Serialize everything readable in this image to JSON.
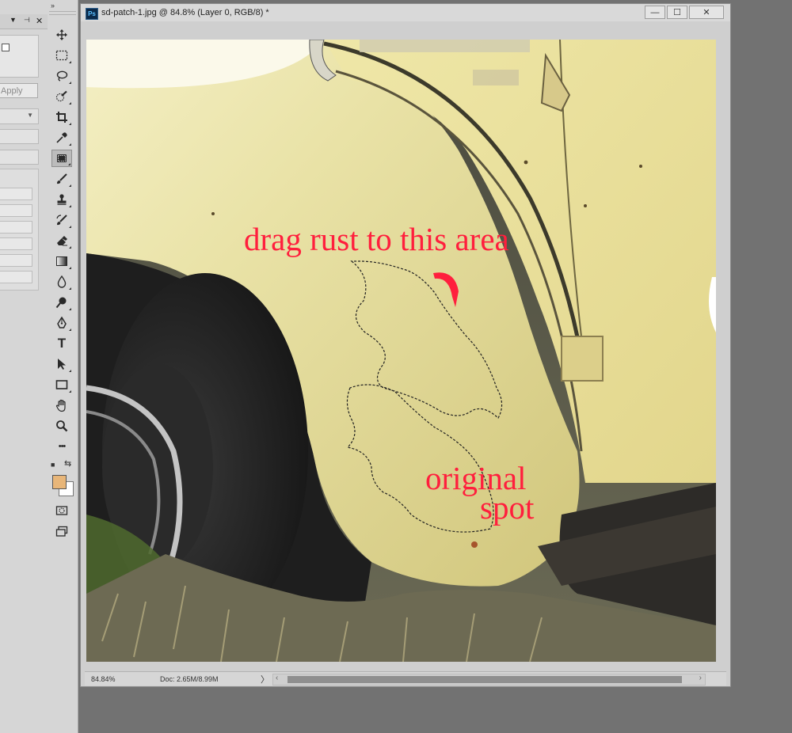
{
  "options_panel": {
    "collapse_icon": "chevron-down-icon",
    "pin_icon": "pin-icon",
    "close_glyph": "✕",
    "apply_label": "Apply"
  },
  "toolbar": {
    "collapse_glyph": "››",
    "tools": [
      {
        "name": "move-icon",
        "active": false
      },
      {
        "name": "marquee-icon",
        "active": false
      },
      {
        "name": "lasso-icon",
        "active": false
      },
      {
        "name": "quick-selection-icon",
        "active": false
      },
      {
        "name": "crop-icon",
        "active": false
      },
      {
        "name": "eyedropper-icon",
        "active": false
      },
      {
        "name": "patch-tool-icon",
        "active": true
      },
      {
        "name": "brush-icon",
        "active": false
      },
      {
        "name": "clone-stamp-icon",
        "active": false
      },
      {
        "name": "history-brush-icon",
        "active": false
      },
      {
        "name": "eraser-icon",
        "active": false
      },
      {
        "name": "gradient-icon",
        "active": false
      },
      {
        "name": "blur-icon",
        "active": false
      },
      {
        "name": "dodge-icon",
        "active": false
      },
      {
        "name": "pen-icon",
        "active": false
      },
      {
        "name": "type-icon",
        "active": false
      },
      {
        "name": "path-selection-icon",
        "active": false
      },
      {
        "name": "rectangle-icon",
        "active": false
      },
      {
        "name": "hand-icon",
        "active": false
      },
      {
        "name": "zoom-icon",
        "active": false
      },
      {
        "name": "more-tools-icon",
        "active": false
      }
    ],
    "type_glyph": "T",
    "more_glyph": "•••",
    "foreground_color": "#e8b679",
    "background_color": "#ffffff"
  },
  "document": {
    "app_badge": "Ps",
    "title": "sd-patch-1.jpg @ 84.8% (Layer 0, RGB/8) *",
    "minimize_glyph": "—",
    "maximize_glyph": "☐",
    "close_glyph": "✕",
    "annotations": {
      "line1": "drag rust to this area",
      "line2": "original",
      "line3": "spot",
      "color": "#ff1f3d"
    },
    "status": {
      "zoom": "84.84%",
      "doc_info": "Doc: 2.65M/8.99M",
      "arrow": "〉",
      "scroll_left": "‹",
      "scroll_right": "›"
    }
  }
}
